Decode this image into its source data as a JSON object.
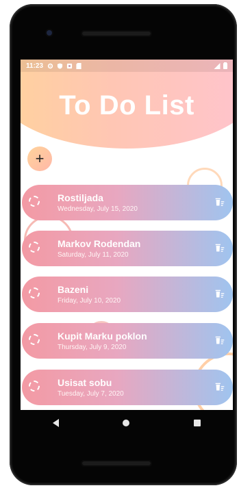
{
  "status": {
    "time": "11:23"
  },
  "header": {
    "title": "To Do List"
  },
  "add_button": {
    "label": "+"
  },
  "tasks": [
    {
      "title": "Rostiljada",
      "date": "Wednesday, July 15, 2020"
    },
    {
      "title": "Markov Rodendan",
      "date": "Saturday, July 11, 2020"
    },
    {
      "title": "Bazeni",
      "date": "Friday, July 10, 2020"
    },
    {
      "title": "Kupit Marku poklon",
      "date": "Thursday, July 9, 2020"
    },
    {
      "title": "Usisat sobu",
      "date": "Tuesday, July 7, 2020"
    }
  ],
  "colors": {
    "header_gradient_start": "#ffd39b",
    "header_gradient_end": "#ffc4cf",
    "task_gradient_start": "#f39aa4",
    "task_gradient_end": "#9fc4ef"
  },
  "icons": [
    "gear-icon",
    "shield-icon",
    "lock-icon",
    "battery-icon",
    "wifi-icon",
    "trash-icon",
    "circle-check-icon"
  ]
}
